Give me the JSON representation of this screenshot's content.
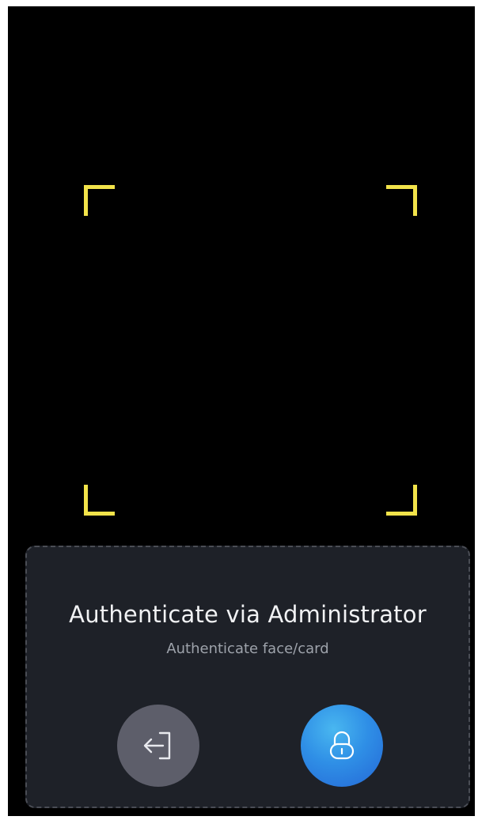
{
  "panel": {
    "title": "Authenticate via Administrator",
    "subtitle": "Authenticate face/card"
  },
  "buttons": {
    "back_icon": "exit-arrow-icon",
    "unlock_icon": "lock-icon"
  },
  "colors": {
    "screen_bg": "#000000",
    "frame_corner": "#f2e34a",
    "panel_bg": "#1e2128",
    "back_button": "#5d5e6a",
    "unlock_button": "#2f8fe6"
  }
}
